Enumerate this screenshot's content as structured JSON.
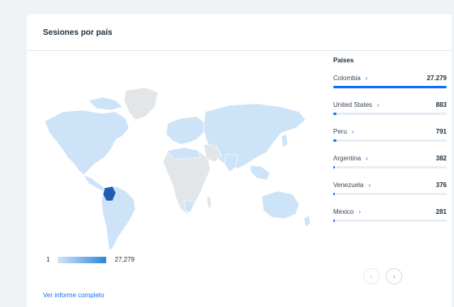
{
  "card": {
    "title": "Sesiones por país",
    "footer_link": "Ver informe completo"
  },
  "legend": {
    "min": "1",
    "max": "27,279"
  },
  "countries": {
    "title": "Países",
    "items": [
      {
        "name": "Colombia",
        "value": "27.279",
        "share": 1.0
      },
      {
        "name": "United States",
        "value": "883",
        "share": 0.032
      },
      {
        "name": "Peru",
        "value": "791",
        "share": 0.029
      },
      {
        "name": "Argentina",
        "value": "382",
        "share": 0.014
      },
      {
        "name": "Venezuela",
        "value": "376",
        "share": 0.014
      },
      {
        "name": "Mexico",
        "value": "281",
        "share": 0.01
      }
    ]
  },
  "colors": {
    "accent": "#116dff",
    "map_low": "#cfe7fb",
    "map_high": "#1e5fb3",
    "map_none": "#e3e6e9"
  },
  "pager": {
    "prev_icon": "chevron-left-icon",
    "next_icon": "chevron-right-icon"
  }
}
